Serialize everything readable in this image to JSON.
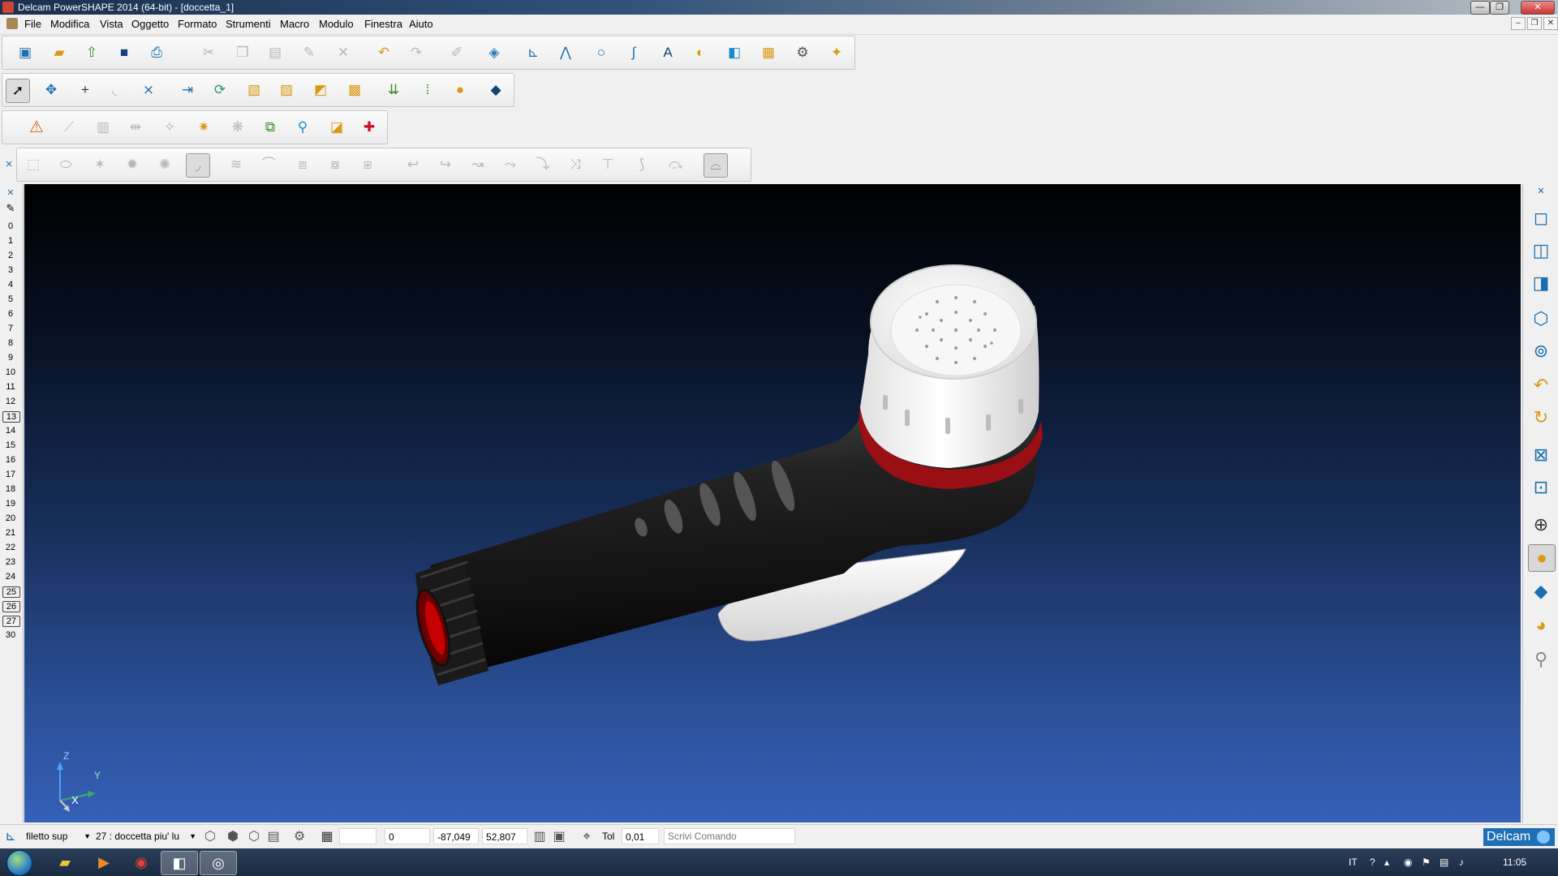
{
  "window": {
    "title": "Delcam PowerSHAPE 2014 (64-bit) - [doccetta_1]",
    "minimize": "—",
    "maximize": "❐",
    "close": "✕"
  },
  "menu": {
    "items": [
      "File",
      "Modifica",
      "Vista",
      "Oggetto",
      "Formato",
      "Strumenti",
      "Macro",
      "Modulo",
      "Finestra",
      "Aiuto"
    ]
  },
  "mdi": {
    "minimize": "–",
    "restore": "❐",
    "close": "✕"
  },
  "toolbars": {
    "row1": [
      "new-document",
      "open-folder",
      "import",
      "save",
      "print",
      "cut",
      "copy",
      "paste",
      "paint",
      "delete",
      "undo",
      "redo",
      "edit",
      "shape",
      "workplane",
      "polyline",
      "circle",
      "arc",
      "text",
      "surface",
      "solid",
      "block",
      "wizard",
      "magic-wand"
    ],
    "row2": [
      "select",
      "transform",
      "point",
      "curve",
      "xy-curve",
      "export",
      "rotate",
      "box",
      "solid-block",
      "cube",
      "multi-block",
      "measure",
      "grid",
      "sphere",
      "pyramid"
    ],
    "row3": [
      "warning",
      "link",
      "split",
      "merge",
      "repair",
      "inspect",
      "fix",
      "morph",
      "analyse",
      "shading",
      "add"
    ],
    "row4": [
      "surface-a",
      "cylinder",
      "star",
      "star2",
      "star3",
      "fillet",
      "blend",
      "sweep",
      "offset",
      "trim",
      "extend",
      "curve-a",
      "curve-b",
      "curve-c",
      "curve-d",
      "curve-e",
      "curve-f",
      "curve-g",
      "curve-h",
      "arch"
    ]
  },
  "levels": {
    "items": [
      "0",
      "1",
      "2",
      "3",
      "4",
      "5",
      "6",
      "7",
      "8",
      "9",
      "10",
      "11",
      "12",
      "13",
      "14",
      "15",
      "16",
      "17",
      "18",
      "19",
      "20",
      "21",
      "22",
      "23",
      "24",
      "25",
      "26",
      "27",
      "30"
    ],
    "boxed": [
      "13",
      "25",
      "26",
      "27"
    ]
  },
  "viewport": {
    "axis": {
      "z": "Z",
      "y": "Y",
      "x": "X"
    }
  },
  "view_tools": [
    "view-iso1",
    "view-iso2",
    "view-iso3",
    "view-iso4",
    "view-camera",
    "view-undo",
    "view-rotate",
    "view-zoom-fit",
    "view-zoom-box",
    "view-wireframe",
    "view-shaded",
    "view-diamond",
    "view-sphere",
    "view-lamp"
  ],
  "statusbar": {
    "object_type": "filetto sup",
    "level": "27 : doccetta piu' lu",
    "coord0": "0",
    "coord_x": "-87,049",
    "coord_y": "52,807",
    "tol_label": "Tol",
    "tol_value": "0,01",
    "command_placeholder": "Scrivi Comando",
    "brand": "Delcam"
  },
  "taskbar": {
    "lang": "IT",
    "time": "11:05"
  },
  "colors": {
    "accent": "#1e6fb5",
    "viewport_top": "#000000",
    "viewport_bottom": "#3560b8",
    "handle": "#1a1a1a",
    "cap": "#f2f2f2",
    "ring": "#9a0f14"
  }
}
